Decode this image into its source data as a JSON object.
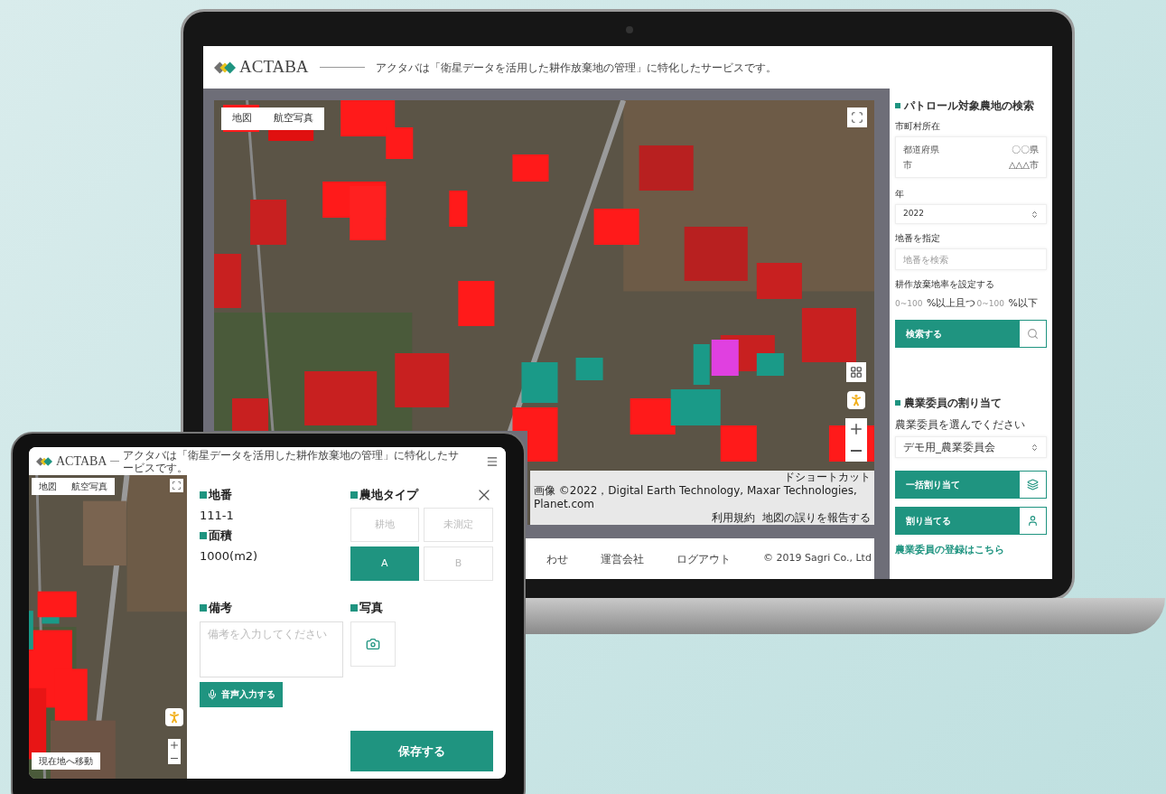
{
  "laptop": {
    "header": {
      "logo": "ACTABA",
      "tagline": "アクタバは「衛星データを活用した耕作放棄地の管理」に特化したサービスです。"
    },
    "map": {
      "tabs": [
        {
          "label": "地図"
        },
        {
          "label": "航空写真"
        }
      ],
      "attribution": [
        "ドショートカット",
        "画像 ©2022，Digital Earth Technology, Maxar Technologies, Planet.com",
        "利用規約",
        "地図の誤りを報告する"
      ]
    },
    "footer": {
      "links": [
        "わせ",
        "運営会社",
        "ログアウト"
      ],
      "copyright": "© 2019 Sagri Co., Ltd"
    },
    "sidebar": {
      "search_title": "パトロール対象農地の検索",
      "location_label": "市町村所在",
      "location_rows": [
        {
          "label": "都道府県",
          "value": "〇〇県"
        },
        {
          "label": "市",
          "value": "△△△市"
        }
      ],
      "year_label": "年",
      "year_value": "2022",
      "parcel_label": "地番を指定",
      "parcel_placeholder": "地番を検索",
      "rate_label": "耕作放棄地率を設定する",
      "rate_min_placeholder": "0~100",
      "rate_min_suffix": "%以上且つ",
      "rate_max_placeholder": "0~100",
      "rate_max_suffix": "%以下",
      "search_button": "検索する",
      "assign_title": "農業委員の割り当て",
      "member_label": "農業委員を選んでください",
      "member_value": "デモ用_農業委員会",
      "bulk_button": "一括割り当て",
      "assign_button": "割り当てる",
      "register_link": "農業委員の登録はこちら"
    }
  },
  "tablet": {
    "header": {
      "logo": "ACTABA",
      "tagline": "アクタバは「衛星データを活用した耕作放棄地の管理」に特化したサービスです。"
    },
    "map": {
      "tabs": [
        {
          "label": "地図"
        },
        {
          "label": "航空写真"
        }
      ],
      "locate_button": "現在地へ移動"
    },
    "form": {
      "parcel_label": "地番",
      "parcel_value": "111-1",
      "area_label": "面積",
      "area_value": "1000(m2)",
      "type_label": "農地タイプ",
      "type_options": [
        {
          "label": "耕地",
          "selected": false
        },
        {
          "label": "未測定",
          "selected": false
        },
        {
          "label": "A",
          "selected": true
        },
        {
          "label": "B",
          "selected": false
        }
      ],
      "note_label": "備考",
      "note_placeholder": "備考を入力してください",
      "voice_button": "音声入力する",
      "photo_label": "写真",
      "save_button": "保存する"
    }
  }
}
